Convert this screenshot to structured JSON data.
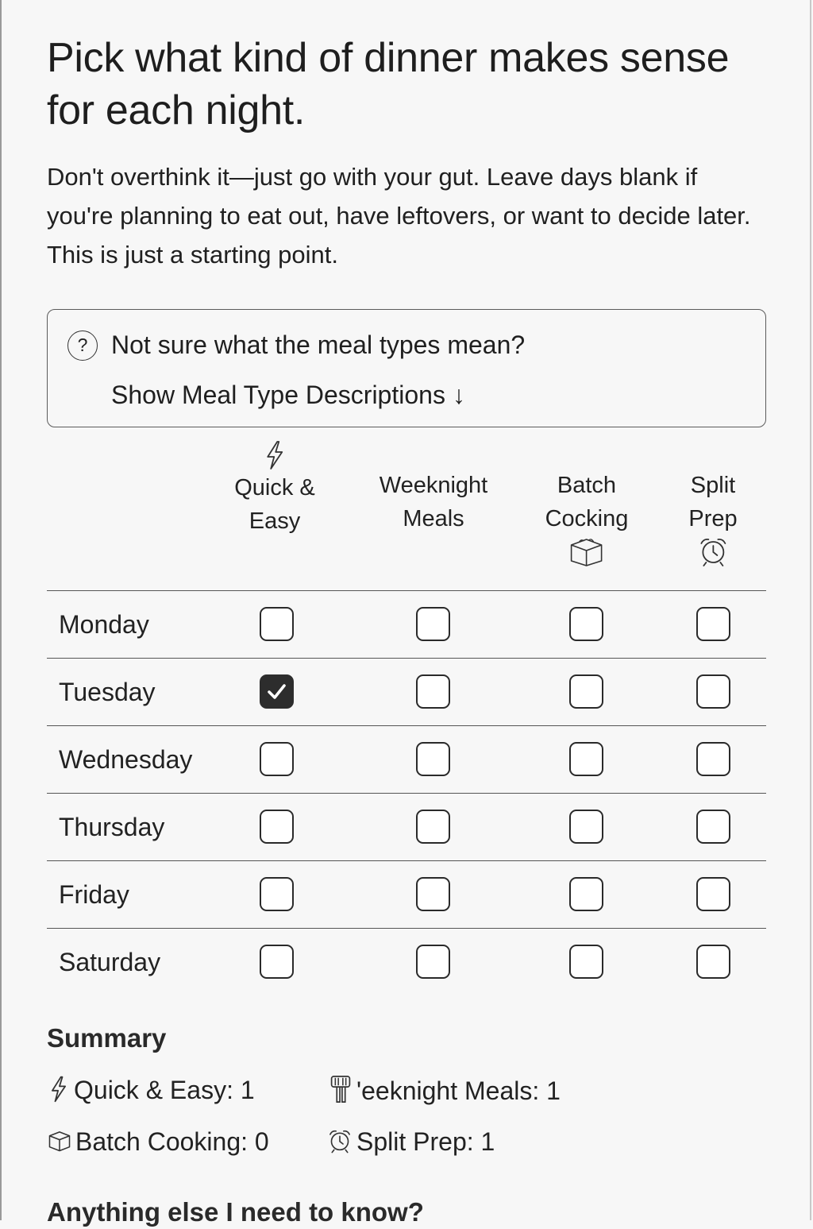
{
  "page": {
    "title": "Pick what kind of dinner makes sense for each night.",
    "intro": "Don't overthink it—just go with your gut. Leave days blank if you're planning to eat out, have leftovers, or want to decide later. This is just a starting point."
  },
  "help": {
    "icon": "question-circle-icon",
    "question": "Not sure what the meal types mean?",
    "link_label": "Show Meal Type Descriptions ↓"
  },
  "columns": [
    {
      "key": "quick",
      "line1": "Quick &",
      "line2": "Easy",
      "icon": "lightning-icon"
    },
    {
      "key": "weeknight",
      "line1": "Weeknight",
      "line2": "Meals",
      "icon": ""
    },
    {
      "key": "batch",
      "line1": "Batch",
      "line2": "Cocking",
      "icon": "box-icon"
    },
    {
      "key": "split",
      "line1": "Split",
      "line2": "Prep",
      "icon": "alarm-clock-icon"
    }
  ],
  "rows": [
    {
      "day": "Monday",
      "checks": [
        false,
        false,
        false,
        false
      ]
    },
    {
      "day": "Tuesday",
      "checks": [
        true,
        false,
        false,
        false
      ]
    },
    {
      "day": "Wednesday",
      "checks": [
        false,
        false,
        false,
        false
      ]
    },
    {
      "day": "Thursday",
      "checks": [
        false,
        false,
        false,
        false
      ]
    },
    {
      "day": "Friday",
      "checks": [
        false,
        false,
        false,
        false
      ]
    },
    {
      "day": "Saturday",
      "checks": [
        false,
        false,
        false,
        false
      ]
    }
  ],
  "summary": {
    "title": "Summary",
    "quick": "Quick & Easy: 1",
    "weeknight": "'eeknight Meals: 1",
    "batch": "Batch Cooking: 0",
    "split": "Split Prep: 1"
  },
  "more_title": "Anything else I need to know?",
  "colors": {
    "accent": "#2d2d2d",
    "background": "#f7f7f7"
  }
}
